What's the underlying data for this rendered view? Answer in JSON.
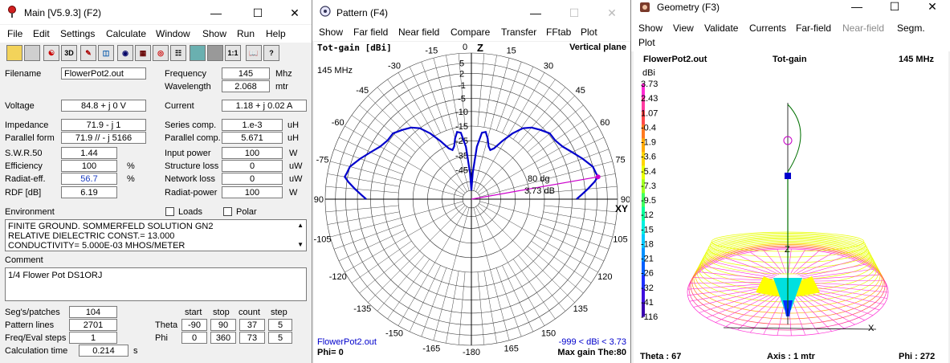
{
  "main": {
    "title": "Main [V5.9.3]   (F2)",
    "menu": [
      "File",
      "Edit",
      "Settings",
      "Calculate",
      "Window",
      "Show",
      "Run",
      "Help"
    ],
    "toolbar_icons": [
      "open-icon",
      "save-icon",
      "antenna-icon",
      "3d-icon",
      "3d-view-icon",
      "edit-icon",
      "globe-icon",
      "grid-icon",
      "target-icon",
      "nec-icon",
      "calculator-icon",
      "grid-view-icon",
      "ratio-icon",
      "book-icon",
      "help-icon"
    ],
    "toolbar_text": {
      "3d": "3D",
      "ratio": "1:1",
      "help": "?"
    },
    "filename_label": "Filename",
    "filename": "FlowerPot2.out",
    "frequency_label": "Frequency",
    "frequency": "145",
    "frequency_unit": "Mhz",
    "wavelength_label": "Wavelength",
    "wavelength": "2.068",
    "wavelength_unit": "mtr",
    "voltage_label": "Voltage",
    "voltage": "84.8 + j 0 V",
    "current_label": "Current",
    "current": "1.18 + j 0.02 A",
    "impedance_label": "Impedance",
    "impedance": "71.9 - j 1",
    "parallel_form_label": "Parallel form",
    "parallel_form": "71.9 // - j 5166",
    "series_comp_label": "Series comp.",
    "series_comp": "1.e-3",
    "series_comp_unit": "uH",
    "parallel_comp_label": "Parallel comp.",
    "parallel_comp": "5.671",
    "parallel_comp_unit": "uH",
    "swr_label": "S.W.R.50",
    "swr": "1.44",
    "efficiency_label": "Efficiency",
    "efficiency": "100",
    "efficiency_unit": "%",
    "radiat_eff_label": "Radiat-eff.",
    "radiat_eff": "56.7",
    "radiat_eff_unit": "%",
    "rdf_label": "RDF [dB]",
    "rdf": "6.19",
    "input_power_label": "Input power",
    "input_power": "100",
    "input_power_unit": "W",
    "structure_loss_label": "Structure loss",
    "structure_loss": "0",
    "structure_loss_unit": "uW",
    "network_loss_label": "Network loss",
    "network_loss": "0",
    "network_loss_unit": "uW",
    "radiat_power_label": "Radiat-power",
    "radiat_power": "100",
    "radiat_power_unit": "W",
    "environment_label": "Environment",
    "loads_label": "Loads",
    "polar_label": "Polar",
    "environment_lines": [
      "FINITE GROUND.  SOMMERFELD SOLUTION GN2",
      "RELATIVE DIELECTRIC CONST.= 13.000",
      "CONDUCTIVITY= 5.000E-03 MHOS/METER"
    ],
    "comment_label": "Comment",
    "comment": "1/4 Flower Pot DS1ORJ",
    "segs_label": "Seg's/patches",
    "segs": "104",
    "pattern_lines_label": "Pattern lines",
    "pattern_lines": "2701",
    "freq_eval_label": "Freq/Eval steps",
    "freq_eval": "1",
    "calc_time_label": "Calculation time",
    "calc_time": "0.214",
    "calc_time_unit": "s",
    "grid_headers": [
      "start",
      "stop",
      "count",
      "step"
    ],
    "theta_label": "Theta",
    "theta": [
      "-90",
      "90",
      "37",
      "5"
    ],
    "phi_label": "Phi",
    "phi": [
      "0",
      "360",
      "73",
      "5"
    ]
  },
  "pattern": {
    "title": "Pattern   (F4)",
    "menu": [
      "Show",
      "Far field",
      "Near field",
      "Compare",
      "Transfer",
      "FFtab",
      "Plot"
    ],
    "top_left": "Tot-gain [dBi]",
    "top_right": "Vertical plane",
    "freq": "145 MHz",
    "z_label": "Z",
    "xy_label": "XY",
    "angle_labels_left": [
      "-15",
      "-30",
      "-45",
      "-60",
      "-75",
      "-90",
      "-105",
      "-120",
      "-135",
      "-150",
      "-165"
    ],
    "angle_labels_right": [
      "15",
      "30",
      "45",
      "60",
      "75",
      "90",
      "105",
      "120",
      "135",
      "150",
      "165"
    ],
    "angle_0": "0",
    "angle_180": "-180",
    "ring_labels": [
      "5",
      "2",
      "-1",
      "-5",
      "-10",
      "-15",
      "-25",
      "-35",
      "-45"
    ],
    "marker_angle": "80 dg",
    "marker_gain": "3.73 dB",
    "file": "FlowerPot2.out",
    "range_text": "-999 < dBi < 3.73",
    "phi_text": "Phi= 0",
    "max_gain_text": "Max gain The:80",
    "colors": {
      "pattern": "#0000cc",
      "marker": "#cc00cc",
      "text_blue": "#0000cc"
    }
  },
  "geometry": {
    "title": "Geometry   (F3)",
    "menu": [
      "Show",
      "View",
      "Validate",
      "Currents",
      "Far-field",
      "Near-field",
      "Segm.",
      "Plot"
    ],
    "file": "FlowerPot2.out",
    "center_label": "Tot-gain",
    "freq": "145 MHz",
    "unit": "dBi",
    "scale_values": [
      "3.73",
      "2.43",
      "1.07",
      "-0.4",
      "-1.9",
      "-3.6",
      "-5.4",
      "-7.3",
      "-9.5",
      "-12",
      "-15",
      "-18",
      "-21",
      "-26",
      "-32",
      "-41",
      "-116"
    ],
    "axis_z": "Z",
    "axis_x": "X",
    "theta_text": "Theta : 67",
    "axis_text": "Axis : 1 mtr",
    "phi_text": "Phi : 272"
  }
}
